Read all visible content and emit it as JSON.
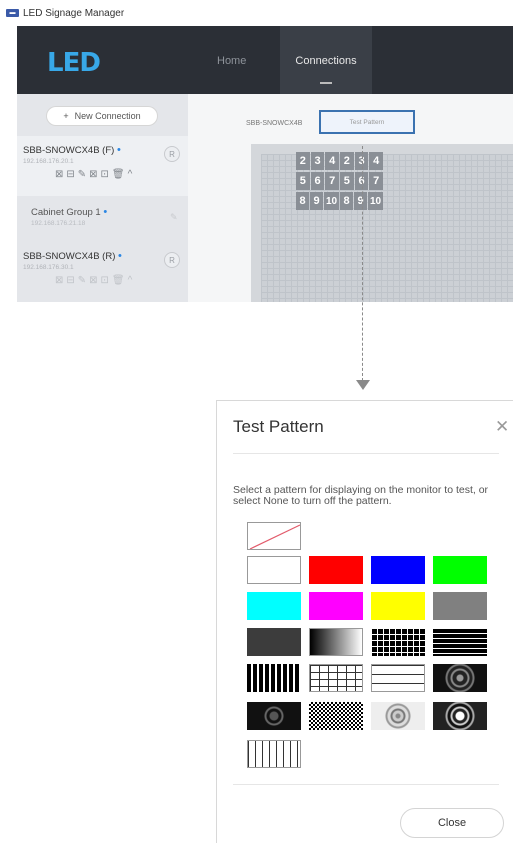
{
  "titlebar": {
    "title": "LED Signage Manager"
  },
  "nav": {
    "brand": "LED",
    "home": "Home",
    "connections": "Connections"
  },
  "sidebar": {
    "new_connection": "New Connection",
    "devices": [
      {
        "name": "SBB-SNOWCX4B (F)",
        "ip": "192.168.176.20.1",
        "badge": "R",
        "tools": "⊠⊟✎⊠⊡🗑^"
      },
      {
        "name": "Cabinet Group 1",
        "ip": "192.168.176.21.18",
        "tools": "✎"
      },
      {
        "name": "SBB-SNOWCX4B (R)",
        "ip": "192.168.176.30.1",
        "badge": "R",
        "tools": "⊠⊟✎⊠⊡🗑^"
      }
    ]
  },
  "main": {
    "tab_device": "SBB-SNOWCX4B",
    "tab_test_pattern": "Test Pattern",
    "cells": [
      [
        "2",
        "3",
        "4",
        "2",
        "3",
        "4"
      ],
      [
        "5",
        "6",
        "7",
        "5",
        "6",
        "7"
      ],
      [
        "8",
        "9",
        "10",
        "8",
        "9",
        "10"
      ]
    ]
  },
  "dialog": {
    "title": "Test Pattern",
    "description": "Select a pattern for displaying on the monitor to test, or select None to turn off the pattern.",
    "close_label": "Close",
    "patterns": [
      "none",
      "white",
      "red",
      "blue",
      "green",
      "cyan",
      "magenta",
      "yellow",
      "gray",
      "dark-gray",
      "gradient",
      "grid-black",
      "horizontal-lines-black",
      "vertical-bars-black",
      "grid-white",
      "horizontal-lines-white",
      "circle-dark",
      "noise-dark",
      "checker-noise",
      "circle-light",
      "circle-ring",
      "vertical-lines-white"
    ]
  },
  "colors": {
    "nav_bg": "#2b2f36",
    "brand": "#38a8e8",
    "highlight_border": "#3b72b0",
    "status_dot": "#2b86e3"
  }
}
